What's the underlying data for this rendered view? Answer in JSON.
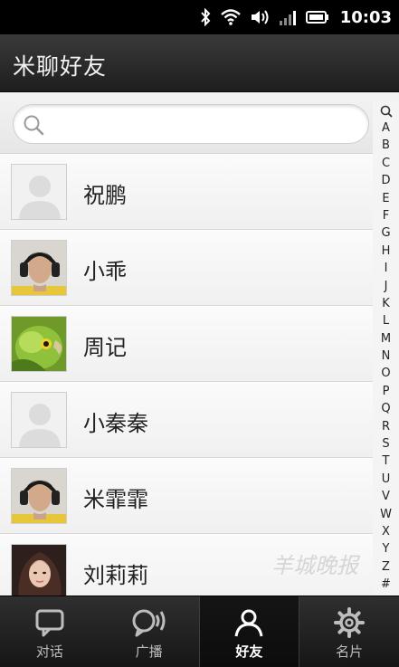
{
  "status_bar": {
    "time": "10:03",
    "icons": [
      "bluetooth-icon",
      "wifi-icon",
      "volume-icon",
      "signal-icon",
      "battery-icon"
    ]
  },
  "header": {
    "title": "米聊好友"
  },
  "search": {
    "placeholder": ""
  },
  "contacts": [
    {
      "name": "祝鹏",
      "avatar": "default-avatar"
    },
    {
      "name": "小乖",
      "avatar": "headphones-photo"
    },
    {
      "name": "周记",
      "avatar": "parrot-photo"
    },
    {
      "name": "小秦秦",
      "avatar": "default-avatar"
    },
    {
      "name": "米霏霏",
      "avatar": "headphones-photo"
    },
    {
      "name": "刘莉莉",
      "avatar": "woman-photo"
    }
  ],
  "index": [
    "A",
    "B",
    "C",
    "D",
    "E",
    "F",
    "G",
    "H",
    "I",
    "J",
    "K",
    "L",
    "M",
    "N",
    "O",
    "P",
    "Q",
    "R",
    "S",
    "T",
    "U",
    "V",
    "W",
    "X",
    "Y",
    "Z",
    "#"
  ],
  "watermark": "羊城晚报",
  "tabs": [
    {
      "label": "对话",
      "icon": "chat-bubble-icon",
      "active": false
    },
    {
      "label": "广播",
      "icon": "broadcast-icon",
      "active": false
    },
    {
      "label": "好友",
      "icon": "person-icon",
      "active": true
    },
    {
      "label": "名片",
      "icon": "gear-icon",
      "active": false
    }
  ],
  "colors": {
    "title_bar": "#2a2a2a",
    "tab_bar": "#1e1e1e",
    "list_bg": "#f4f4f4",
    "text": "#222222"
  }
}
